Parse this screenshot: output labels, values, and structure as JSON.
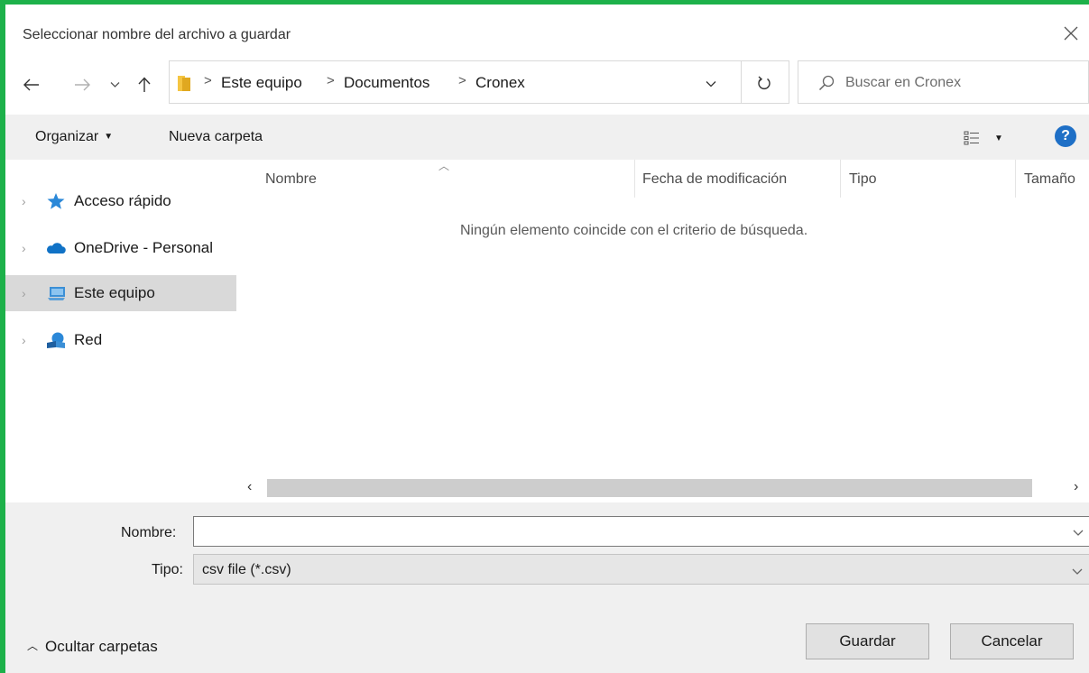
{
  "window": {
    "title": "Seleccionar nombre del archivo a guardar",
    "close_icon": "close-icon"
  },
  "nav": {
    "back_icon": "arrow-left-icon",
    "forward_icon": "arrow-right-icon",
    "recent_icon": "chevron-down-icon",
    "up_icon": "arrow-up-icon"
  },
  "address": {
    "folder_icon": "folder-icon",
    "crumbs": [
      "Este equipo",
      "Documentos",
      "Cronex"
    ],
    "separator": ">",
    "dropdown_icon": "chevron-down-icon",
    "refresh_icon": "refresh-icon"
  },
  "search": {
    "placeholder": "Buscar en Cronex",
    "icon": "search-icon"
  },
  "toolbar": {
    "organize_label": "Organizar",
    "new_folder_label": "Nueva carpeta",
    "view_icon": "view-options-icon",
    "help_label": "?"
  },
  "sidebar": {
    "items": [
      {
        "label": "Acceso rápido",
        "icon": "star-icon",
        "selected": false
      },
      {
        "label": "OneDrive - Personal",
        "icon": "cloud-icon",
        "selected": false
      },
      {
        "label": "Este equipo",
        "icon": "computer-icon",
        "selected": true
      },
      {
        "label": "Red",
        "icon": "network-icon",
        "selected": false
      }
    ]
  },
  "filelist": {
    "columns": [
      "Nombre",
      "Fecha de modificación",
      "Tipo",
      "Tamaño"
    ],
    "empty_message": "Ningún elemento coincide con el criterio de búsqueda."
  },
  "form": {
    "name_label": "Nombre:",
    "name_value": "",
    "type_label": "Tipo:",
    "type_value": "csv file (*.csv)"
  },
  "footer": {
    "hide_folders_label": "Ocultar carpetas",
    "save_label": "Guardar",
    "cancel_label": "Cancelar"
  },
  "colors": {
    "frame_accent": "#1db14a",
    "selected_bg": "#d9d9d9",
    "help_blue": "#1e6fc6",
    "star_blue": "#2b88d8",
    "folder_yellow": "#f5c542"
  }
}
